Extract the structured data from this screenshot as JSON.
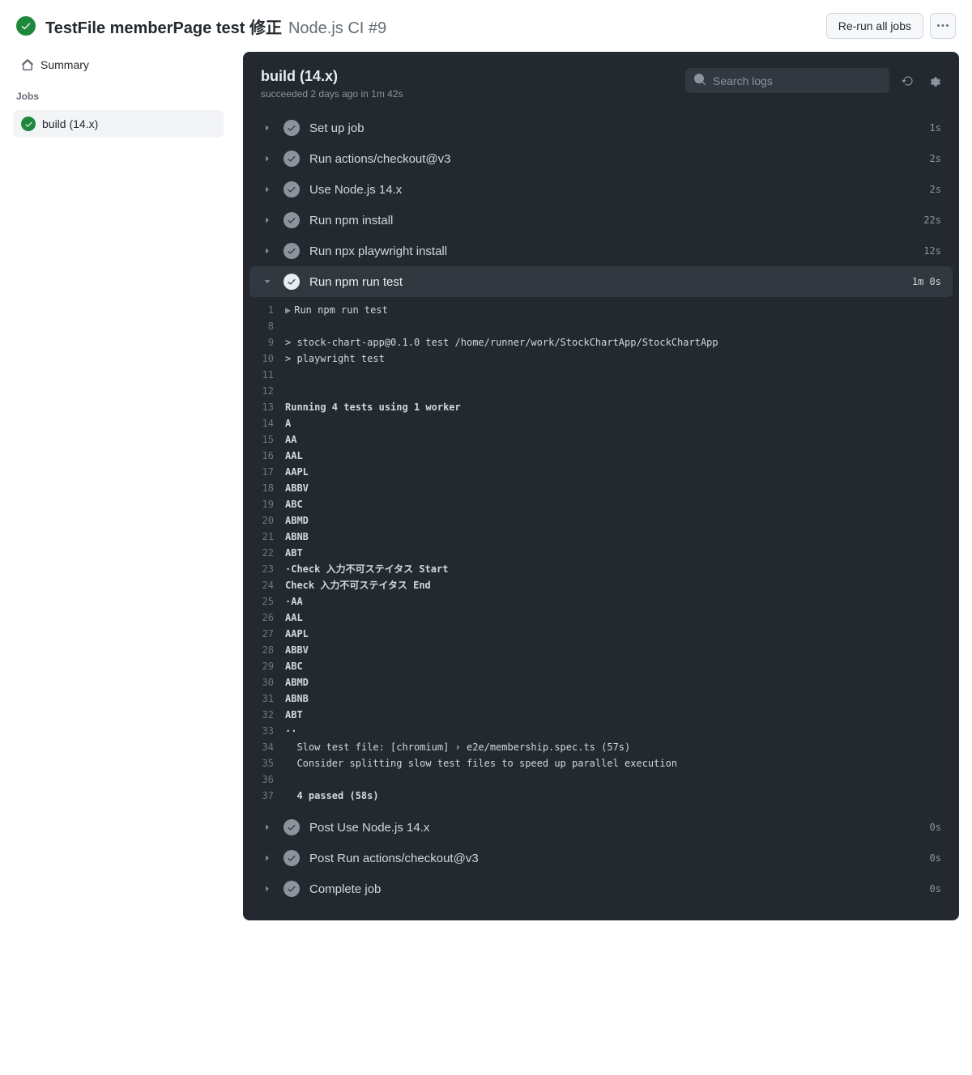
{
  "header": {
    "title_main": "TestFile memberPage test 修正",
    "title_muted": "Node.js CI #9",
    "rerun_label": "Re-run all jobs"
  },
  "sidebar": {
    "summary_label": "Summary",
    "jobs_heading": "Jobs",
    "jobs": [
      {
        "label": "build (14.x)"
      }
    ]
  },
  "panel": {
    "title": "build (14.x)",
    "status_prefix": "succeeded",
    "status_time": "2 days ago",
    "status_in": "in",
    "status_duration": "1m 42s",
    "search_placeholder": "Search logs"
  },
  "steps": [
    {
      "name": "Set up job",
      "time": "1s",
      "expanded": false
    },
    {
      "name": "Run actions/checkout@v3",
      "time": "2s",
      "expanded": false
    },
    {
      "name": "Use Node.js 14.x",
      "time": "2s",
      "expanded": false
    },
    {
      "name": "Run npm install",
      "time": "22s",
      "expanded": false
    },
    {
      "name": "Run npx playwright install",
      "time": "12s",
      "expanded": false
    },
    {
      "name": "Run npm run test",
      "time": "1m 0s",
      "expanded": true
    },
    {
      "name": "Post Use Node.js 14.x",
      "time": "0s",
      "expanded": false
    },
    {
      "name": "Post Run actions/checkout@v3",
      "time": "0s",
      "expanded": false
    },
    {
      "name": "Complete job",
      "time": "0s",
      "expanded": false
    }
  ],
  "log_first_line": {
    "n": "1",
    "text": "Run npm run test",
    "caret": true
  },
  "log_lines": [
    {
      "n": "8",
      "text": ""
    },
    {
      "n": "9",
      "text": "> stock-chart-app@0.1.0 test /home/runner/work/StockChartApp/StockChartApp"
    },
    {
      "n": "10",
      "text": "> playwright test"
    },
    {
      "n": "11",
      "text": ""
    },
    {
      "n": "12",
      "text": ""
    },
    {
      "n": "13",
      "text": "Running 4 tests using 1 worker",
      "bold": true
    },
    {
      "n": "14",
      "text": "A",
      "bold": true
    },
    {
      "n": "15",
      "text": "AA",
      "bold": true
    },
    {
      "n": "16",
      "text": "AAL",
      "bold": true
    },
    {
      "n": "17",
      "text": "AAPL",
      "bold": true
    },
    {
      "n": "18",
      "text": "ABBV",
      "bold": true
    },
    {
      "n": "19",
      "text": "ABC",
      "bold": true
    },
    {
      "n": "20",
      "text": "ABMD",
      "bold": true
    },
    {
      "n": "21",
      "text": "ABNB",
      "bold": true
    },
    {
      "n": "22",
      "text": "ABT",
      "bold": true
    },
    {
      "n": "23",
      "text": "·Check 入力不可ステイタス Start",
      "bold": true
    },
    {
      "n": "24",
      "text": "Check 入力不可ステイタス End",
      "bold": true
    },
    {
      "n": "25",
      "text": "·AA",
      "bold": true
    },
    {
      "n": "26",
      "text": "AAL",
      "bold": true
    },
    {
      "n": "27",
      "text": "AAPL",
      "bold": true
    },
    {
      "n": "28",
      "text": "ABBV",
      "bold": true
    },
    {
      "n": "29",
      "text": "ABC",
      "bold": true
    },
    {
      "n": "30",
      "text": "ABMD",
      "bold": true
    },
    {
      "n": "31",
      "text": "ABNB",
      "bold": true
    },
    {
      "n": "32",
      "text": "ABT",
      "bold": true
    },
    {
      "n": "33",
      "text": "··",
      "bold": true
    },
    {
      "n": "34",
      "text": "  Slow test file: [chromium] › e2e/membership.spec.ts (57s)"
    },
    {
      "n": "35",
      "text": "  Consider splitting slow test files to speed up parallel execution"
    },
    {
      "n": "36",
      "text": ""
    },
    {
      "n": "37",
      "text": "  4 passed (58s)",
      "bold": true
    }
  ]
}
